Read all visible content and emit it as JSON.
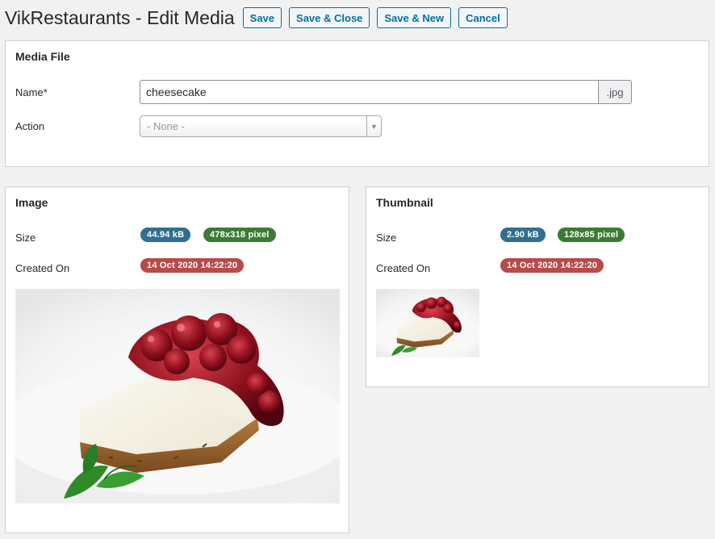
{
  "header": {
    "title": "VikRestaurants - Edit Media",
    "buttons": {
      "save": "Save",
      "save_close": "Save & Close",
      "save_new": "Save & New",
      "cancel": "Cancel"
    }
  },
  "media_file": {
    "title": "Media File",
    "name_label": "Name*",
    "name_value": "cheesecake",
    "extension": ".jpg",
    "action_label": "Action",
    "action_selected": "- None -"
  },
  "image": {
    "title": "Image",
    "size_label": "Size",
    "size": "44.94 kB",
    "dimensions": "478x318 pixel",
    "created_label": "Created On",
    "created": "14 Oct 2020 14:22:20",
    "image_subject": "cheesecake-photo"
  },
  "thumbnail": {
    "title": "Thumbnail",
    "size_label": "Size",
    "size": "2.90 kB",
    "dimensions": "128x85 pixel",
    "created_label": "Created On",
    "created": "14 Oct 2020 14:22:20",
    "image_subject": "cheesecake-thumbnail"
  },
  "colors": {
    "accent": "#0071a1",
    "badge_blue": "#2f6f8f",
    "badge_green": "#3b7b33",
    "badge_red": "#b94a48"
  }
}
